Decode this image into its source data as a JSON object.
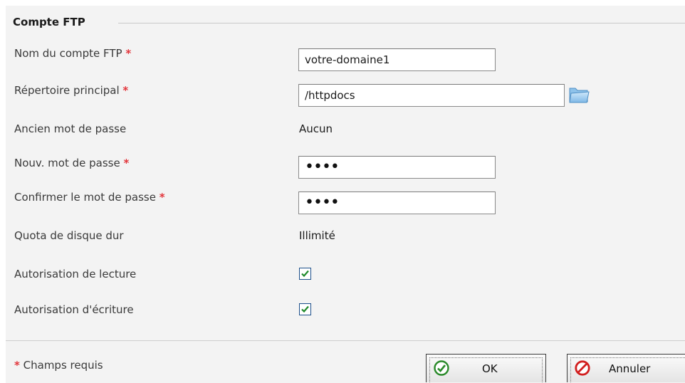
{
  "section": {
    "title": "Compte FTP"
  },
  "required_marker": "*",
  "fields": {
    "ftp_account_name": {
      "label": "Nom du compte FTP",
      "value": "votre-domaine1"
    },
    "home_directory": {
      "label": "Répertoire principal",
      "value": "/httpdocs"
    },
    "old_password": {
      "label": "Ancien mot de passe",
      "value": "Aucun"
    },
    "new_password": {
      "label": "Nouv. mot de passe",
      "value": "••••"
    },
    "confirm_password": {
      "label": "Confirmer le mot de passe",
      "value": "••••"
    },
    "disk_quota": {
      "label": "Quota de disque dur",
      "value": "Illimité"
    },
    "read_permission": {
      "label": "Autorisation de lecture",
      "checked": true
    },
    "write_permission": {
      "label": "Autorisation d'écriture",
      "checked": true
    }
  },
  "footer": {
    "required_note": "Champs requis",
    "ok_label": "OK",
    "cancel_label": "Annuler"
  },
  "icons": {
    "folder": "folder-icon",
    "ok": "check-circle-icon",
    "cancel": "forbidden-icon",
    "checkbox": "checkmark-icon"
  },
  "colors": {
    "required": "#e2343a",
    "check": "#1f8a2a",
    "ok_icon": "#2a8a2a",
    "cancel_icon": "#d21f1f",
    "panel_bg": "#f3f3f3"
  }
}
